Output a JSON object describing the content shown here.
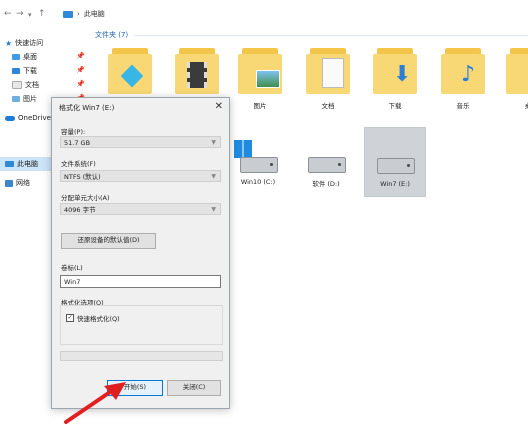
{
  "explorer": {
    "nav_back": "←",
    "nav_forward": "→",
    "nav_recent": "▾",
    "nav_up": "↑",
    "breadcrumb_sep": "›",
    "breadcrumb_location": "此电脑"
  },
  "sidebar": {
    "quick_access": "快速访问",
    "items": [
      {
        "label": "桌面",
        "pinned": "📌"
      },
      {
        "label": "下载",
        "pinned": "📌"
      },
      {
        "label": "文档",
        "pinned": "📌"
      },
      {
        "label": "图片",
        "pinned": "📌"
      }
    ],
    "onedrive": "OneDrive",
    "this_pc": "此电脑",
    "network": "网络"
  },
  "folders": {
    "header": "文件夹 (7)",
    "items": [
      {
        "label": "",
        "icon": "3d-objects-icon"
      },
      {
        "label": "",
        "icon": "video-icon"
      },
      {
        "label": "图片",
        "icon": "picture-icon"
      },
      {
        "label": "文档",
        "icon": "document-icon"
      },
      {
        "label": "下载",
        "icon": "download-icon"
      },
      {
        "label": "音乐",
        "icon": "music-icon"
      },
      {
        "label": "桌",
        "icon": "desktop-icon"
      }
    ]
  },
  "drives": [
    {
      "label": "Win10 (C:)",
      "icon": "windows-drive-icon"
    },
    {
      "label": "软件 (D:)",
      "icon": "drive-icon"
    },
    {
      "label": "Win7 (E:)",
      "icon": "drive-icon",
      "selected": true
    }
  ],
  "dialog": {
    "title": "格式化 Win7 (E:)",
    "close": "✕",
    "capacity_label": "容量(P):",
    "capacity_value": "51.7 GB",
    "filesystem_label": "文件系统(F)",
    "filesystem_value": "NTFS (默认)",
    "alloc_label": "分配单元大小(A)",
    "alloc_value": "4096 字节",
    "restore_button": "还原设备的默认值(D)",
    "volume_label": "卷标(L)",
    "volume_value": "Win7",
    "format_options_label": "格式化选项(O)",
    "quick_format_label": "快速格式化(Q)",
    "quick_format_check": "✓",
    "start_button": "开始(S)",
    "close_button": "关闭(C)"
  },
  "colors": {
    "accent": "#0078d7",
    "arrow": "#e02020",
    "folder": "#f8d775"
  }
}
